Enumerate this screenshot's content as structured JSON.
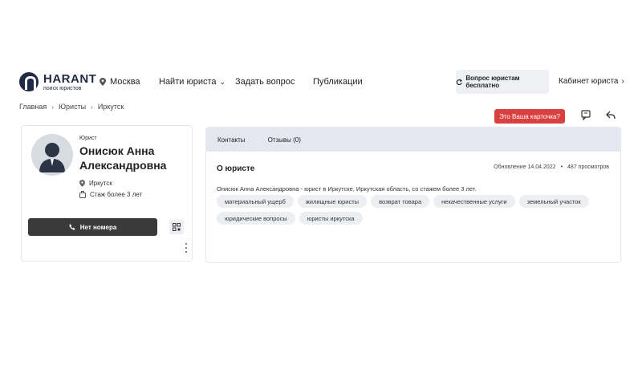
{
  "header": {
    "logo_title": "HARANT",
    "logo_subtitle": "поиск юристов",
    "city": "Москва",
    "nav": [
      {
        "label": "Найти юриста"
      },
      {
        "label": "Задать вопрос"
      },
      {
        "label": "Публикации"
      }
    ],
    "ask_button": "Вопрос юристам бесплатно",
    "cabinet_link": "Кабинет юриста"
  },
  "breadcrumb": [
    "Главная",
    "Юристы",
    "Иркутск"
  ],
  "actions": {
    "your_card_button": "Это Ваша карточка?",
    "chat_icon": "chat-icon",
    "share_icon": "share-icon"
  },
  "profile": {
    "role": "Юрист",
    "name_line1": "Онисюк Анна",
    "name_line2": "Александровна",
    "city": "Иркутск",
    "experience": "Стаж более 3 лет",
    "phone_button": "Нет номера"
  },
  "panel": {
    "tabs": [
      {
        "label": "Контакты"
      },
      {
        "label": "Отзывы (0)"
      }
    ],
    "section_title": "О юристе",
    "updated": "Обновление 14.04.2022",
    "separator": "•",
    "views": "487 просмотров",
    "description": "Онисюк Анна Александровна - юрист в Иркутске, Иркутская область, со стажем более 3 лет.",
    "tags": [
      "материальный ущерб",
      "жилищные юристы",
      "возврат товара",
      "некачественные услуги",
      "земельный участок",
      "юридические вопросы",
      "юристы иркутска"
    ]
  },
  "colors": {
    "accent_red": "#d94141",
    "dark_button": "#3a3a3a",
    "tab_bar": "#e4e7ef",
    "brand": "#1f2a44"
  }
}
